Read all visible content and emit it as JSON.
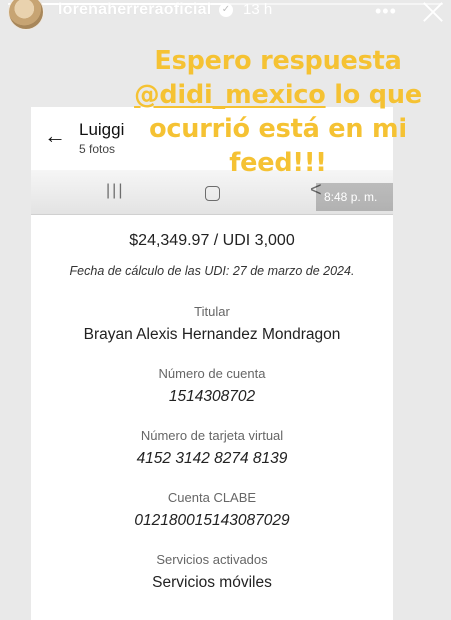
{
  "story": {
    "progress": 0.5,
    "username": "lorenaherreraoficial",
    "verified_mark": "✓",
    "time": "13 h",
    "more_icon": "•••",
    "close_icon": "close-icon",
    "text_line1": "Espero respuesta",
    "mention": "@didi_mexico",
    "text_line2_rest": " lo que",
    "text_line3": "ocurrió está en mi",
    "text_line4": "feed!!!",
    "text_color": "#f5c233"
  },
  "screenshot": {
    "header": {
      "back_icon": "←",
      "contact_name": "Luiggi",
      "photo_count": "5 fotos"
    },
    "navbar": {
      "recent_icon": "|||",
      "home_icon": "home-icon",
      "back_icon": "<",
      "time": "8:48 p. m."
    },
    "details": {
      "amount": "$24,349.97 / UDI 3,000",
      "udi_date": "Fecha de cálculo de las UDI: 27 de marzo de 2024.",
      "holder_label": "Titular",
      "holder_value": "Brayan Alexis Hernandez Mondragon",
      "account_label": "Número de cuenta",
      "account_value": "1514308702",
      "card_label": "Número de tarjeta virtual",
      "card_value": "4152 3142 8274 8139",
      "clabe_label": "Cuenta CLABE",
      "clabe_value": "012180015143087029",
      "services_label": "Servicios activados",
      "services_value": "Servicios móviles"
    }
  }
}
